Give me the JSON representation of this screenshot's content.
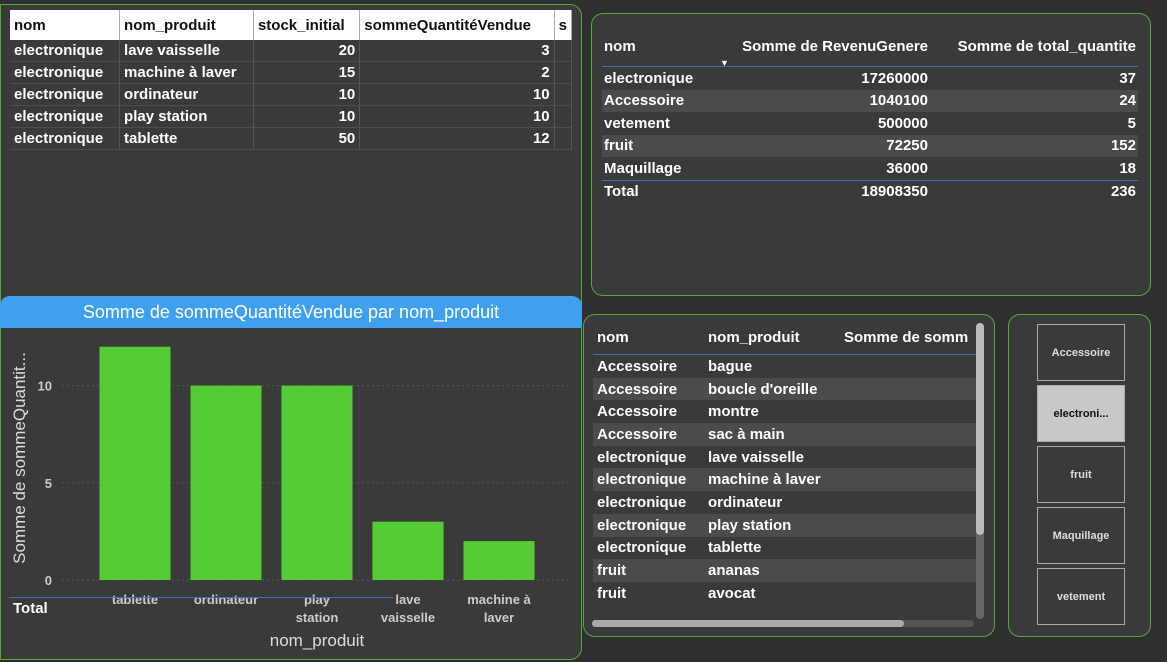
{
  "table1": {
    "headers": [
      "nom",
      "nom_produit",
      "stock_initial",
      "sommeQuantitéVendue"
    ],
    "rows": [
      [
        "electronique",
        "lave vaisselle",
        "20",
        "3"
      ],
      [
        "electronique",
        "machine à laver",
        "15",
        "2"
      ],
      [
        "electronique",
        "ordinateur",
        "10",
        "10"
      ],
      [
        "electronique",
        "play station",
        "10",
        "10"
      ],
      [
        "electronique",
        "tablette",
        "50",
        "12"
      ]
    ]
  },
  "chart_data": {
    "type": "bar",
    "title": "Somme de sommeQuantitéVendue par nom_produit",
    "xlabel": "nom_produit",
    "ylabel": "Somme de sommeQuantit...",
    "categories": [
      "tablette",
      "ordinateur",
      "play station",
      "lave vaisselle",
      "machine à laver"
    ],
    "category_lines": [
      [
        "tablette"
      ],
      [
        "ordinateur"
      ],
      [
        "play",
        "station"
      ],
      [
        "lave",
        "vaisselle"
      ],
      [
        "machine à",
        "laver"
      ]
    ],
    "values": [
      12,
      10,
      10,
      3,
      2
    ],
    "yticks": [
      "0",
      "5",
      "10"
    ],
    "ylim": [
      0,
      12.5
    ],
    "bar_color": "#55cc33",
    "grid": true
  },
  "table2": {
    "headers": [
      "nom",
      "Somme de RevenuGenere",
      "Somme de total_quantite"
    ],
    "rows": [
      [
        "electronique",
        "17260000",
        "37"
      ],
      [
        "Accessoire",
        "1040100",
        "24"
      ],
      [
        "vetement",
        "500000",
        "5"
      ],
      [
        "fruit",
        "72250",
        "152"
      ],
      [
        "Maquillage",
        "36000",
        "18"
      ]
    ],
    "total": [
      "Total",
      "18908350",
      "236"
    ]
  },
  "table3": {
    "headers": [
      "nom",
      "nom_produit",
      "Somme de somm"
    ],
    "rows": [
      [
        "Accessoire",
        "bague"
      ],
      [
        "Accessoire",
        "boucle d'oreille"
      ],
      [
        "Accessoire",
        "montre"
      ],
      [
        "Accessoire",
        "sac à main"
      ],
      [
        "electronique",
        "lave vaisselle"
      ],
      [
        "electronique",
        "machine à laver"
      ],
      [
        "electronique",
        "ordinateur"
      ],
      [
        "electronique",
        "play station"
      ],
      [
        "electronique",
        "tablette"
      ],
      [
        "fruit",
        "ananas"
      ],
      [
        "fruit",
        "avocat"
      ]
    ],
    "total": "Total"
  },
  "slicer": {
    "items": [
      "Accessoire",
      "electroni...",
      "fruit",
      "Maquillage",
      "vetement"
    ],
    "selected": "electroni..."
  },
  "colors": {
    "accent": "#40a0f0",
    "border": "#57a83a",
    "bar": "#55cc33"
  }
}
